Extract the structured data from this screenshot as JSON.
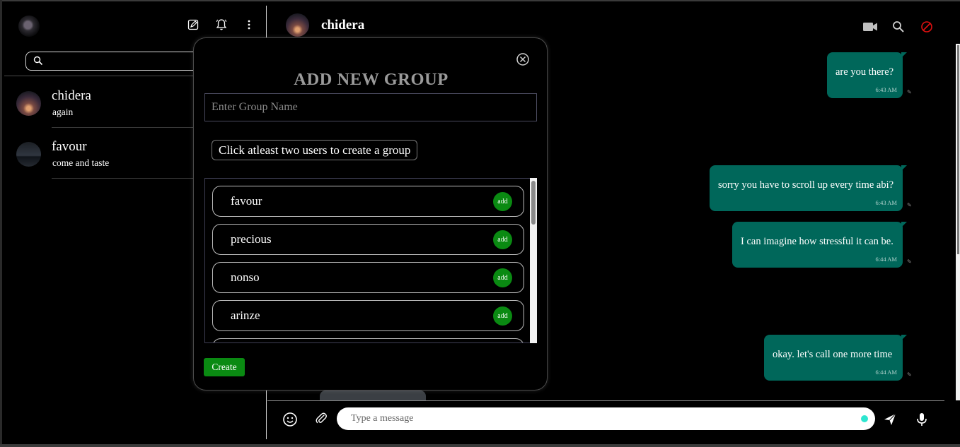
{
  "sidebar": {
    "search": {
      "placeholder": ""
    },
    "chats": [
      {
        "name": "chidera",
        "preview": "again"
      },
      {
        "name": "favour",
        "preview": "come and taste"
      }
    ]
  },
  "chat": {
    "contact_name": "chidera",
    "messages": [
      {
        "text": "are you there?",
        "time": "6:43 AM"
      },
      {
        "text": "sorry you have to scroll up every time abi?",
        "time": "6:43 AM"
      },
      {
        "text": "I can imagine how stressful it can be.",
        "time": "6:44 AM"
      },
      {
        "text": "okay. let's call one more time",
        "time": "6:44 AM"
      }
    ],
    "composer": {
      "placeholder": "Type a message"
    }
  },
  "modal": {
    "title": "ADD NEW GROUP",
    "group_name_placeholder": "Enter Group Name",
    "hint": "Click atleast two users to create a group",
    "users": [
      {
        "name": "favour",
        "action": "add"
      },
      {
        "name": "precious",
        "action": "add"
      },
      {
        "name": "nonso",
        "action": "add"
      },
      {
        "name": "arinze",
        "action": "add"
      }
    ],
    "create_label": "Create"
  },
  "colors": {
    "bubble": "#00675a",
    "add_button": "#0a8a12",
    "block_icon": "#e01010",
    "typing_dot": "#2de6d0"
  }
}
